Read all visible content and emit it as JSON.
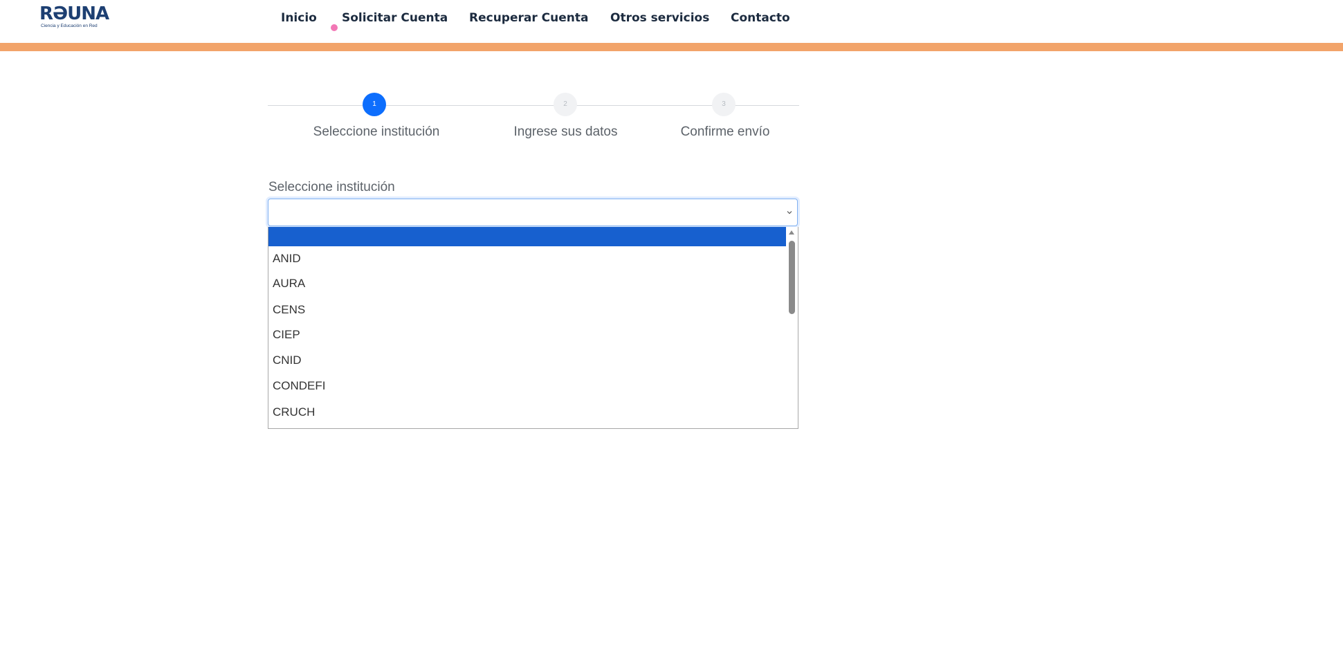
{
  "logo": {
    "text": "RƏUNA",
    "tagline": "Ciencia y Educación en Red"
  },
  "nav": {
    "items": [
      "Inicio",
      "Solicitar Cuenta",
      "Recuperar Cuenta",
      "Otros servicios",
      "Contacto"
    ],
    "active_index": 1,
    "active_dot_color": "#f277b5"
  },
  "accent_bar_color": "#f2a46a",
  "stepper": {
    "steps": [
      {
        "number": "1",
        "label": "Seleccione institución",
        "active": true
      },
      {
        "number": "2",
        "label": "Ingrese sus datos",
        "active": false
      },
      {
        "number": "3",
        "label": "Confirme envío",
        "active": false
      }
    ]
  },
  "form": {
    "label": "Seleccione institución",
    "selected_value": "",
    "options": [
      "",
      "ANID",
      "AURA",
      "CENS",
      "CIEP",
      "CNID",
      "CONDEFI",
      "CRUCH"
    ]
  }
}
